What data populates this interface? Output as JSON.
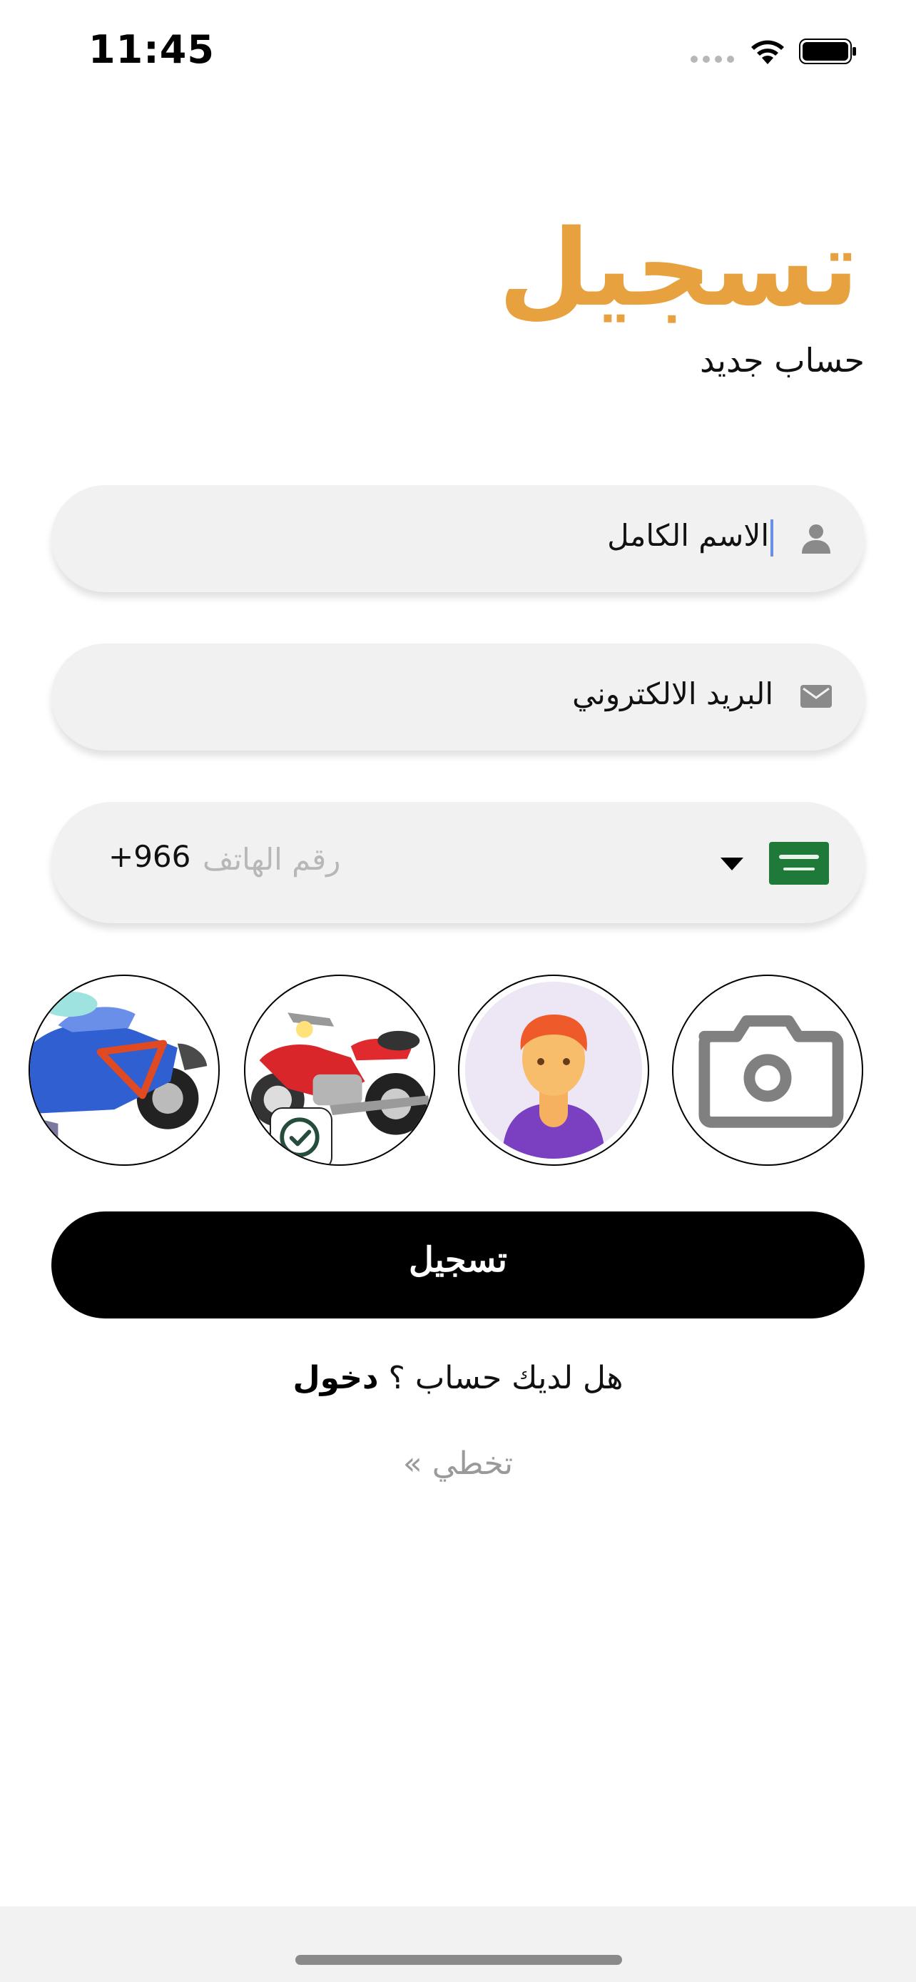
{
  "status_bar": {
    "time": "11:45"
  },
  "header": {
    "title": "تسجيل",
    "subtitle": "حساب جديد"
  },
  "form": {
    "name_field": {
      "value": "الاسم الكامل",
      "icon": "person-icon"
    },
    "email_field": {
      "value": "البريد الالكتروني",
      "icon": "mail-icon"
    },
    "phone_field": {
      "country_code": "+966",
      "placeholder": "رقم الهاتف",
      "country_flag": "saudi-flag-icon"
    }
  },
  "avatars": {
    "items": [
      "camera-icon",
      "person-avatar",
      "red-motorcycle-avatar",
      "blue-motorcycle-avatar"
    ],
    "selected": "red-motorcycle-avatar"
  },
  "actions": {
    "submit_label": "تسجيل",
    "login_prompt": "هل لديك حساب ؟",
    "login_link": "دخول",
    "skip_label": "تخطي »"
  },
  "colors": {
    "accent": "#e7a13e",
    "field_bg": "#f1f1f1",
    "button_bg": "#000000",
    "muted_text": "#9a9a9a"
  }
}
